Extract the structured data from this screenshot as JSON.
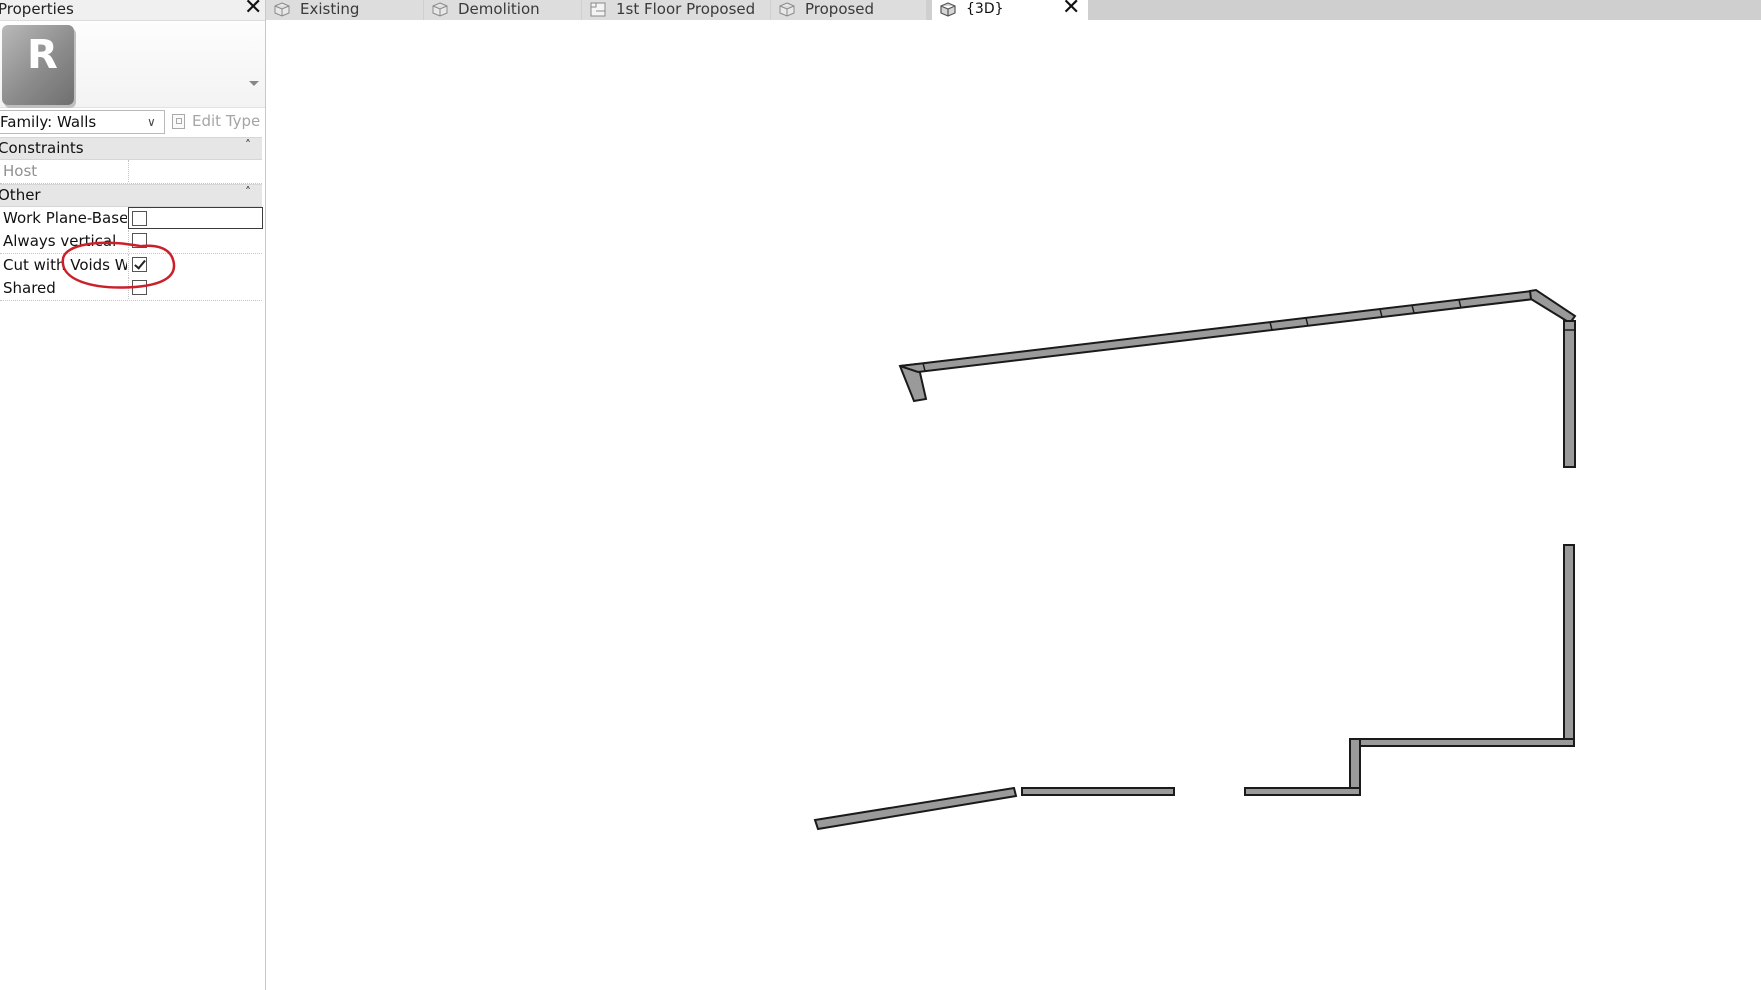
{
  "properties": {
    "title": "Properties",
    "type_selector": {
      "family_label": "Family: Walls",
      "edit_type_label": "Edit Type"
    },
    "groups": [
      {
        "name": "Constraints",
        "rows": [
          {
            "label": "Host",
            "value": ""
          }
        ]
      },
      {
        "name": "Other",
        "rows": [
          {
            "label": "Work Plane-Based",
            "checked": false
          },
          {
            "label": "Always vertical",
            "checked": false
          },
          {
            "label": "Cut with Voids W...",
            "checked": true
          },
          {
            "label": "Shared",
            "checked": false
          }
        ]
      }
    ]
  },
  "tabs": [
    {
      "label": "Existing",
      "icon": "3d-view-icon",
      "active": false
    },
    {
      "label": "Demolition",
      "icon": "3d-view-icon",
      "active": false
    },
    {
      "label": "1st Floor Proposed",
      "icon": "floor-plan-icon",
      "active": false
    },
    {
      "label": "Proposed",
      "icon": "3d-view-icon",
      "active": false
    },
    {
      "label": "{3D}",
      "icon": "3d-view-icon",
      "active": true
    }
  ],
  "colors": {
    "annotation": "#cc1f2a",
    "wall_fill": "#9a9a9a",
    "wall_stroke": "#1a1a1a"
  }
}
